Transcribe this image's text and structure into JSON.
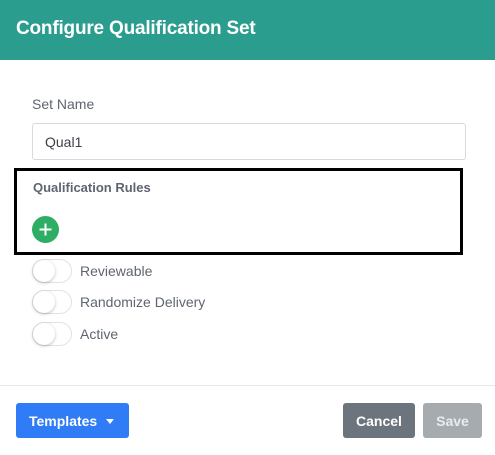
{
  "dialog": {
    "title": "Configure Qualification Set"
  },
  "set_name": {
    "label": "Set Name",
    "value": "Qual1"
  },
  "qualification_rules": {
    "label": "Qualification Rules",
    "add_icon": "plus-icon"
  },
  "toggles": [
    {
      "label": "Reviewable",
      "checked": false
    },
    {
      "label": "Randomize Delivery",
      "checked": false
    },
    {
      "label": "Active",
      "checked": false
    }
  ],
  "footer": {
    "templates_label": "Templates",
    "cancel_label": "Cancel",
    "save_label": "Save",
    "save_disabled": true
  },
  "colors": {
    "header_background": "#2a9d8f",
    "add_button": "#2eae65",
    "templates_button": "#2f7cf6",
    "cancel_button": "#6c757d",
    "save_button_disabled": "#a6abb0"
  }
}
